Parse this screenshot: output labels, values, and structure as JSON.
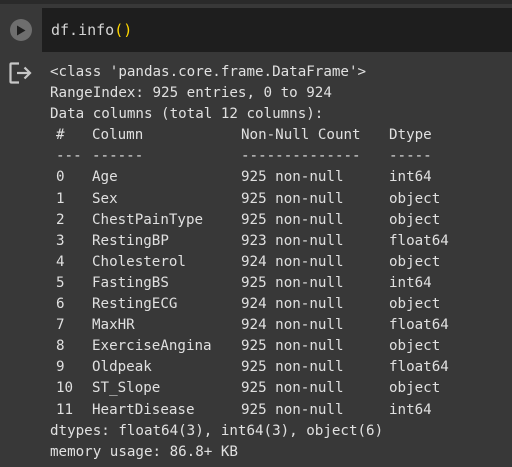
{
  "code_cell": {
    "code_prefix": "df.info",
    "code_parens": "()"
  },
  "output": {
    "line_class": "<class 'pandas.core.frame.DataFrame'>",
    "line_range": "RangeIndex: 925 entries, 0 to 924",
    "line_cols": "Data columns (total 12 columns):",
    "header": {
      "idx": "#",
      "col": "Column",
      "count": "Non-Null Count",
      "dtype": "Dtype"
    },
    "separator": {
      "idx": "---",
      "col": "------",
      "count": "--------------",
      "dtype": "-----"
    },
    "rows": [
      {
        "idx": "0",
        "col": "Age",
        "count": "925 non-null",
        "dtype": "int64"
      },
      {
        "idx": "1",
        "col": "Sex",
        "count": "925 non-null",
        "dtype": "object"
      },
      {
        "idx": "2",
        "col": "ChestPainType",
        "count": "925 non-null",
        "dtype": "object"
      },
      {
        "idx": "3",
        "col": "RestingBP",
        "count": "923 non-null",
        "dtype": "float64"
      },
      {
        "idx": "4",
        "col": "Cholesterol",
        "count": "924 non-null",
        "dtype": "object"
      },
      {
        "idx": "5",
        "col": "FastingBS",
        "count": "925 non-null",
        "dtype": "int64"
      },
      {
        "idx": "6",
        "col": "RestingECG",
        "count": "924 non-null",
        "dtype": "object"
      },
      {
        "idx": "7",
        "col": "MaxHR",
        "count": "924 non-null",
        "dtype": "float64"
      },
      {
        "idx": "8",
        "col": "ExerciseAngina",
        "count": "925 non-null",
        "dtype": "object"
      },
      {
        "idx": "9",
        "col": "Oldpeak",
        "count": "925 non-null",
        "dtype": "float64"
      },
      {
        "idx": "10",
        "col": "ST_Slope",
        "count": "925 non-null",
        "dtype": "object"
      },
      {
        "idx": "11",
        "col": "HeartDisease",
        "count": "925 non-null",
        "dtype": "int64"
      }
    ],
    "line_dtypes": "dtypes: float64(3), int64(3), object(6)",
    "line_memory": "memory usage: 86.8+ KB"
  },
  "icons": {
    "run": "play-circle-icon",
    "output": "output-redirect-icon"
  },
  "colors": {
    "background": "#383838",
    "editor_bg": "#1e1e1e",
    "text": "#e0e0e0",
    "paren": "#ffd700",
    "run_button": "#6e6e6e"
  }
}
